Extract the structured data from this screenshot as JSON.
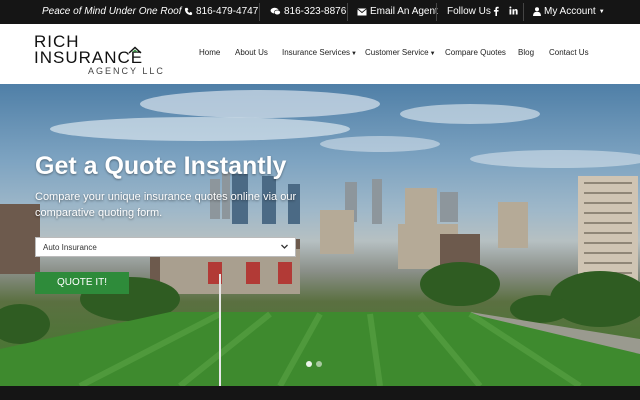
{
  "topbar": {
    "tagline": "Peace of Mind Under One Roof",
    "phone1": "816-479-4747",
    "phone2": "816-323-8876",
    "email_label": "Email An Agent",
    "follow_label": "Follow Us",
    "account_label": "My Account"
  },
  "logo": {
    "line1": "RICH",
    "line2": "INSURANCE",
    "line3": "AGENCY LLC"
  },
  "nav": {
    "home": "Home",
    "about": "About Us",
    "insurance": "Insurance Services",
    "customer": "Customer Service",
    "compare": "Compare Quotes",
    "blog": "Blog",
    "contact": "Contact Us"
  },
  "hero": {
    "title": "Get a Quote Instantly",
    "subtitle": "Compare your unique insurance quotes online via our comparative quoting form.",
    "select_value": "Auto Insurance",
    "button_label": "QUOTE IT!"
  },
  "colors": {
    "accent": "#2e8b3a",
    "topbar": "#151515"
  },
  "icons": [
    "phone-icon",
    "mobile-icon",
    "envelope-icon",
    "facebook-icon",
    "linkedin-icon",
    "user-icon",
    "chevron-down-icon",
    "house-icon"
  ]
}
